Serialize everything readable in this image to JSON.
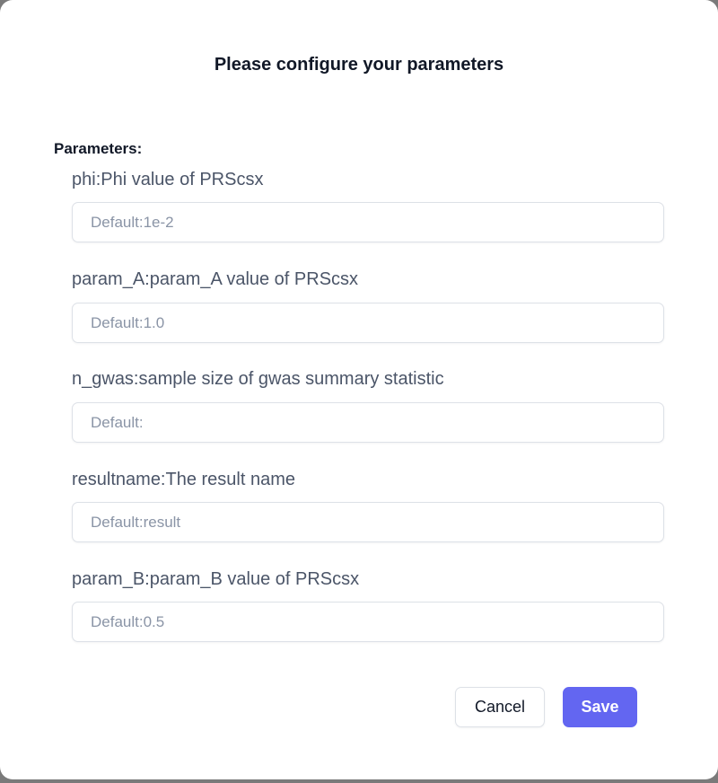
{
  "dialog": {
    "title": "Please configure your parameters",
    "section_label": "Parameters:"
  },
  "fields": [
    {
      "label": "phi:Phi value of PRScsx",
      "placeholder": "Default:1e-2",
      "value": ""
    },
    {
      "label": "param_A:param_A value of PRScsx",
      "placeholder": "Default:1.0",
      "value": ""
    },
    {
      "label": "n_gwas:sample size of gwas summary statistic",
      "placeholder": "Default:",
      "value": ""
    },
    {
      "label": "resultname:The result name",
      "placeholder": "Default:result",
      "value": ""
    },
    {
      "label": "param_B:param_B value of PRScsx",
      "placeholder": "Default:0.5",
      "value": ""
    }
  ],
  "buttons": {
    "cancel_label": "Cancel",
    "save_label": "Save"
  },
  "colors": {
    "primary": "#6366f1",
    "text_dark": "#111827",
    "label_text": "#4b5568",
    "placeholder_text": "#8a94a6",
    "border": "#dde1e7"
  }
}
